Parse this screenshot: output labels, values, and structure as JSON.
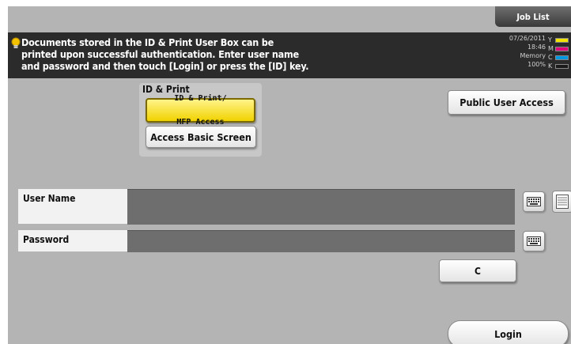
{
  "topbar": {
    "job_list_label": "Job List"
  },
  "message": {
    "lines": [
      "Documents stored in the ID & Print User Box can be",
      "printed upon successful authentication. Enter user name",
      "and password and then touch [Login] or press the [ID] key."
    ]
  },
  "status": {
    "date": "07/26/2011",
    "time": "18:46",
    "memory_label": "Memory",
    "memory_value": "100%",
    "toner": [
      {
        "label": "Y",
        "color": "#f2e300"
      },
      {
        "label": "M",
        "color": "#e2007a"
      },
      {
        "label": "C",
        "color": "#0096e0"
      },
      {
        "label": "K",
        "color": "#1a1a1a"
      }
    ]
  },
  "id_print": {
    "title": "ID & Print",
    "access_button_line1": "ID & Print/",
    "access_button_line2": "MFP Access",
    "basic_button": "Access Basic Screen"
  },
  "public_access_button": "Public User Access",
  "fields": {
    "user_name_label": "User Name",
    "user_name_value": "",
    "password_label": "Password",
    "password_value": ""
  },
  "buttons": {
    "clear": "C",
    "login": "Login"
  },
  "icons": {
    "keyboard": "keyboard-icon",
    "user_list": "user-list-icon",
    "message": "lightbulb-icon"
  }
}
